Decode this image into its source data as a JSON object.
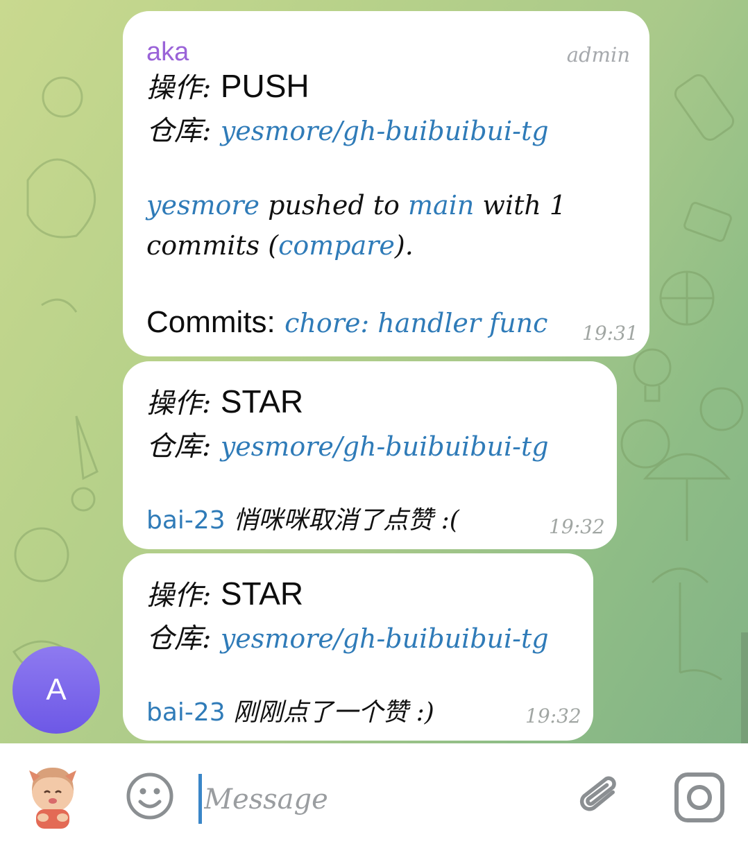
{
  "messages": [
    {
      "sender": "aka",
      "badge": "admin",
      "action_label": "操作:",
      "action_value": "PUSH",
      "repo_label": "仓库:",
      "repo_link": "yesmore/gh-buibuibui-tg",
      "body_user": "yesmore",
      "body_text1": " pushed to ",
      "body_branch": "main",
      "body_text2": " with 1",
      "body_text3": "commits (",
      "body_compare": "compare",
      "body_text4": ").",
      "commits_label": "Commits:",
      "commit_link": "chore: handler func",
      "time": "19:31"
    },
    {
      "action_label": "操作:",
      "action_value": "STAR",
      "repo_label": "仓库:",
      "repo_link": "yesmore/gh-buibuibui-tg",
      "user": "bai-23",
      "text": " 悄咪咪取消了点赞 :(",
      "time": "19:32"
    },
    {
      "action_label": "操作:",
      "action_value": "STAR",
      "repo_label": "仓库:",
      "repo_link": "yesmore/gh-buibuibui-tg",
      "user": "bai-23",
      "text": " 刚刚点了一个赞 :)",
      "time": "19:32"
    }
  ],
  "avatar": {
    "initial": "A",
    "color": "#7b66ea"
  },
  "composer": {
    "placeholder": "Message"
  },
  "icons": [
    "sticker-icon",
    "emoji-icon",
    "attach-icon",
    "camera-icon"
  ],
  "colors": {
    "link": "#2f7bb8",
    "sender": "#9a63d8",
    "bubble": "#ffffff"
  }
}
